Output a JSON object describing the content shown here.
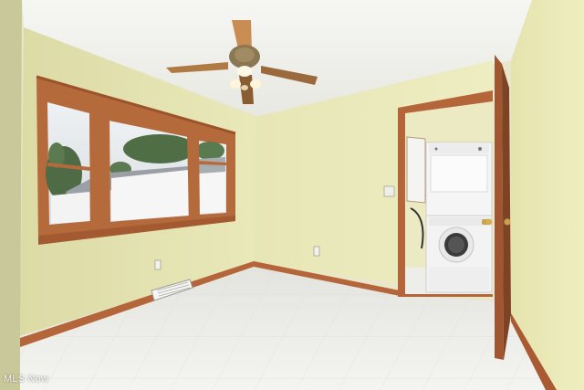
{
  "photo": {
    "subject": "",
    "watermark": "MLS Now",
    "colors": {
      "wall": "#e6e5b3",
      "wall_shadow": "#d6d49f",
      "ceiling": "#f1f1ec",
      "floor": "#eeeeea",
      "trim": "#b5653a",
      "door": "#a05630",
      "appliance": "#f4f4f4"
    }
  }
}
